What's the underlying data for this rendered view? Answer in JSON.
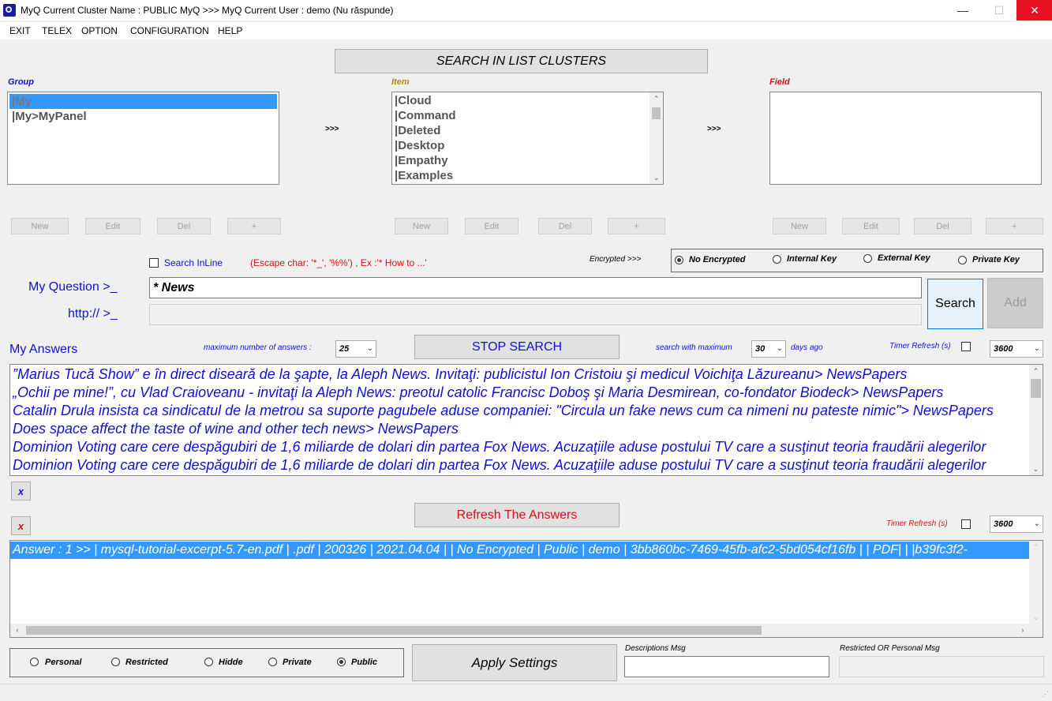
{
  "window": {
    "title": "MyQ Current Cluster Name : PUBLIC MyQ >>> MyQ Current User : demo (Nu răspunde)",
    "minimize": "—",
    "maximize": "☐",
    "close": "✕"
  },
  "menu": [
    "EXIT",
    "TELEX",
    "OPTION",
    "CONFIGURATION",
    "HELP"
  ],
  "search_clusters_label": "SEARCH IN LIST CLUSTERS",
  "group": {
    "label": "Group",
    "items": [
      "|My",
      "|My>MyPanel"
    ],
    "selected": 0
  },
  "item": {
    "label": "Item",
    "items": [
      "|Cloud",
      "|Command",
      "|Deleted",
      "|Desktop",
      "|Empathy",
      "|Examples"
    ]
  },
  "field": {
    "label": "Field",
    "items": []
  },
  "arrow_label": ">>>",
  "list_buttons": {
    "new": "New",
    "edit": "Edit",
    "del": "Del",
    "plus": "+"
  },
  "search_inline_label": "Search InLine",
  "escape_hint": "(Escape char: '*_', '%%') , Ex :'* How to ...'",
  "encrypted": {
    "label": "Encrypted >>>",
    "options": [
      "No Encrypted",
      "Internal Key",
      "External Key",
      "Private Key"
    ],
    "selected": "No Encrypted"
  },
  "question": {
    "label": "My Question >_",
    "value": "* News"
  },
  "http": {
    "label": "http:// >_",
    "value": ""
  },
  "search_button": "Search",
  "add_button": "Add",
  "answers": {
    "label": "My Answers",
    "max_label": "maximum number of answers :",
    "max_value": "25",
    "stop_button": "STOP SEARCH",
    "days_label": "search with maximum",
    "days_value": "30",
    "days_suffix": "days ago",
    "timer_label": "Timer Refresh (s)",
    "timer_value": "3600",
    "lines": [
      "”Marius Tucă Show” e în direct diseară de la şapte, la Aleph News. Invitaţi: publicistul Ion Cristoiu şi medicul Voichiţa Lăzureanu> NewsPapers",
      "„Ochii pe mine!”, cu Vlad Craioveanu - invitaţi la Aleph News: preotul catolic Francisc Doboş şi Maria Desmirean, co-fondator Biodeck> NewsPapers",
      "Catalin Drula insista ca sindicatul de la metrou sa suporte pagubele aduse companiei: \"Circula un fake news cum ca nimeni nu pateste nimic\"> NewsPapers",
      "Does space affect the taste of wine and other tech news> NewsPapers",
      "Dominion Voting care cere despăgubiri de 1,6 miliarde de dolari din partea Fox News. Acuzaţiile aduse postului TV care a susţinut teoria fraudării alegerilor",
      "Dominion Voting care cere despăgubiri de 1,6 miliarde de dolari din partea Fox News. Acuzaţiile aduse postului TV care a susţinut teoria fraudării alegerilor"
    ]
  },
  "clear_x": "x",
  "refresh": {
    "button": "Refresh The Answers",
    "timer_label": "Timer Refresh (s)",
    "timer_value": "3600"
  },
  "detail_line": "Answer : 1 >> | mysql-tutorial-excerpt-5.7-en.pdf | .pdf | 200326 | 2021.04.04 |  | No Encrypted | Public | demo | 3bb860bc-7469-45fb-afc2-5bd054cf16fb |  | PDF|   | |b39fc3f2-",
  "visibility": {
    "options": [
      "Personal",
      "Restricted",
      "Hidde",
      "Private",
      "Public"
    ],
    "selected": "Public"
  },
  "apply_button": "Apply Settings",
  "descriptions_label": "Descriptions Msg",
  "restricted_label": "Restricted OR Personal Msg",
  "colors": {
    "blue_text": "#1010d0",
    "red_text": "#d41010",
    "selection": "#3399ff",
    "close_red": "#e81123",
    "item_label": "#b8860b"
  }
}
